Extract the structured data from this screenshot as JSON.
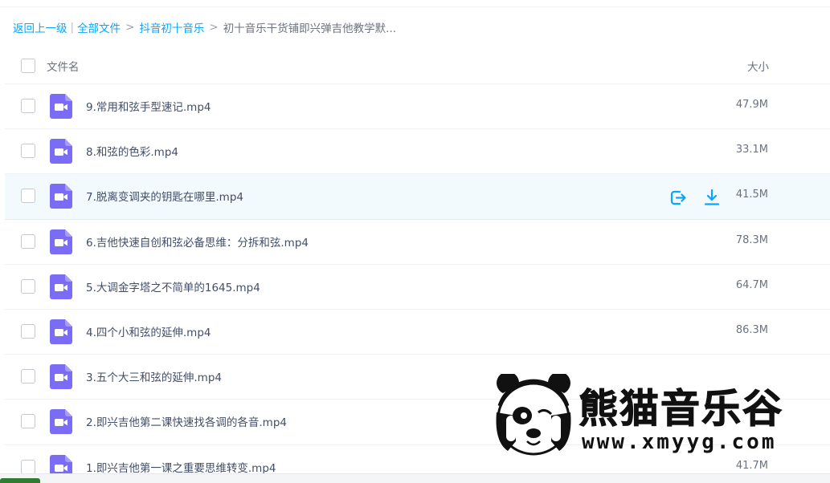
{
  "breadcrumb": {
    "back": "返回上一级",
    "all_files": "全部文件",
    "folder": "抖音初十音乐",
    "current": "初十音乐干货铺即兴弹吉他教学默...",
    "sep_bar": "|",
    "sep_arrow": ">"
  },
  "header": {
    "name_label": "文件名",
    "size_label": "大小"
  },
  "files": [
    {
      "name": "9.常用和弦手型速记.mp4",
      "size": "47.9M"
    },
    {
      "name": "8.和弦的色彩.mp4",
      "size": "33.1M"
    },
    {
      "name": "7.脱离变调夹的钥匙在哪里.mp4",
      "size": "41.5M",
      "hovered": true
    },
    {
      "name": "6.吉他快速自创和弦必备思维：分拆和弦.mp4",
      "size": "78.3M"
    },
    {
      "name": "5.大调金字塔之不简单的1645.mp4",
      "size": "64.7M"
    },
    {
      "name": "4.四个小和弦的延伸.mp4",
      "size": "86.3M"
    },
    {
      "name": "3.五个大三和弦的延伸.mp4",
      "size": ""
    },
    {
      "name": "2.即兴吉他第二课快速找各调的各音.mp4",
      "size": ""
    },
    {
      "name": "1.即兴吉他第一课之重要思维转变.mp4",
      "size": "41.7M"
    }
  ],
  "watermark": {
    "text": "熊猫音乐谷",
    "url": "www.xmyyg.com"
  },
  "colors": {
    "accent": "#06a7ff",
    "video_icon": "#7b6cf6",
    "hover_row": "#f2fafd"
  },
  "icons": {
    "file_type": "video-file-icon",
    "share": "share-icon",
    "download": "download-icon"
  }
}
